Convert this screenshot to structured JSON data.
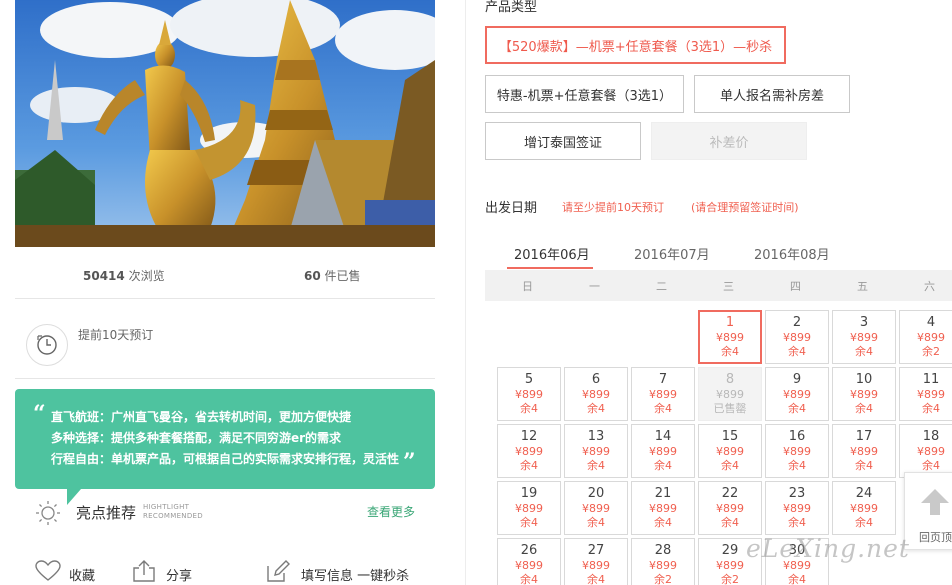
{
  "stats": {
    "views_count": "50414",
    "views_label": "次浏览",
    "sold_count": "60",
    "sold_label": "件已售"
  },
  "advance": {
    "text": "提前10天预订"
  },
  "features": {
    "line1": "直飞航班：广州直飞曼谷，省去转机时间，更加方便快捷",
    "line2": "多种选择：提供多种套餐搭配，满足不同穷游er的需求",
    "line3": "行程自由：单机票产品，可根据自己的实际需求安排行程，灵活性"
  },
  "highlight": {
    "title": "亮点推荐",
    "en_line1": "HIGHTLIGHT",
    "en_line2": "RECOMMENDED",
    "more": "查看更多"
  },
  "bottom_actions": {
    "favorite": "收藏",
    "share": "分享",
    "fill_info": "填写信息 一键秒杀"
  },
  "product": {
    "section_label": "产品类型",
    "options": [
      "【520爆款】—机票+任意套餐（3选1）—秒杀",
      "特惠-机票+任意套餐（3选1）",
      "单人报名需补房差",
      "增订泰国签证",
      "补差价"
    ]
  },
  "departure": {
    "title": "出发日期",
    "note1": "请至少提前10天预订",
    "note2": "(请合理预留签证时间)",
    "months": [
      "2016年06月",
      "2016年07月",
      "2016年08月"
    ],
    "weekdays": [
      "日",
      "一",
      "二",
      "三",
      "四",
      "五",
      "六"
    ],
    "days": [
      {
        "d": "1",
        "p": "¥899",
        "r": "余4"
      },
      {
        "d": "2",
        "p": "¥899",
        "r": "余4"
      },
      {
        "d": "3",
        "p": "¥899",
        "r": "余4"
      },
      {
        "d": "4",
        "p": "¥899",
        "r": "余2"
      },
      {
        "d": "5",
        "p": "¥899",
        "r": "余4"
      },
      {
        "d": "6",
        "p": "¥899",
        "r": "余4"
      },
      {
        "d": "7",
        "p": "¥899",
        "r": "余4"
      },
      {
        "d": "8",
        "p": "¥899",
        "r": "已售罄"
      },
      {
        "d": "9",
        "p": "¥899",
        "r": "余4"
      },
      {
        "d": "10",
        "p": "¥899",
        "r": "余4"
      },
      {
        "d": "11",
        "p": "¥899",
        "r": "余4"
      },
      {
        "d": "12",
        "p": "¥899",
        "r": "余4"
      },
      {
        "d": "13",
        "p": "¥899",
        "r": "余4"
      },
      {
        "d": "14",
        "p": "¥899",
        "r": "余4"
      },
      {
        "d": "15",
        "p": "¥899",
        "r": "余4"
      },
      {
        "d": "16",
        "p": "¥899",
        "r": "余4"
      },
      {
        "d": "17",
        "p": "¥899",
        "r": "余4"
      },
      {
        "d": "18",
        "p": "¥899",
        "r": "余4"
      },
      {
        "d": "19",
        "p": "¥899",
        "r": "余4"
      },
      {
        "d": "20",
        "p": "¥899",
        "r": "余4"
      },
      {
        "d": "21",
        "p": "¥899",
        "r": "余4"
      },
      {
        "d": "22",
        "p": "¥899",
        "r": "余4"
      },
      {
        "d": "23",
        "p": "¥899",
        "r": "余4"
      },
      {
        "d": "24",
        "p": "¥899",
        "r": "余4"
      },
      {
        "d": "26",
        "p": "¥899",
        "r": "余4"
      },
      {
        "d": "27",
        "p": "¥899",
        "r": "余4"
      },
      {
        "d": "28",
        "p": "¥899",
        "r": "余2"
      },
      {
        "d": "29",
        "p": "¥899",
        "r": "余2"
      },
      {
        "d": "30",
        "p": "¥899",
        "r": "余4"
      }
    ]
  },
  "back_top": {
    "label": "回页顶"
  },
  "watermark": "eLeXing.net"
}
